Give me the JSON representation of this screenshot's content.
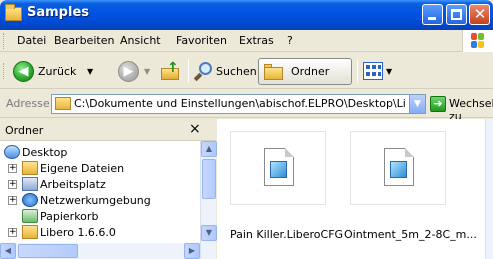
{
  "window": {
    "title": "Samples"
  },
  "menu": [
    "Datei",
    "Bearbeiten",
    "Ansicht",
    "Favoriten",
    "Extras",
    "?"
  ],
  "toolbar": {
    "back_label": "Zurück",
    "search_label": "Suchen",
    "folders_label": "Ordner"
  },
  "address": {
    "label": "Adresse",
    "path": "C:\\Dokumente und Einstellungen\\abischof.ELPRO\\Desktop\\Li",
    "go_label": "Wechseln zu"
  },
  "folder_pane": {
    "title": "Ordner",
    "close_glyph": "×",
    "tree": [
      {
        "label": "Desktop",
        "icon": "desktop-icon",
        "level": 0
      },
      {
        "label": "Eigene Dateien",
        "icon": "my-documents-icon",
        "level": 1
      },
      {
        "label": "Arbeitsplatz",
        "icon": "my-computer-icon",
        "level": 1
      },
      {
        "label": "Netzwerkumgebung",
        "icon": "network-icon",
        "level": 1
      },
      {
        "label": "Papierkorb",
        "icon": "recycle-bin-icon",
        "level": 1
      },
      {
        "label": "Libero 1.6.6.0",
        "icon": "folder-icon",
        "level": 1
      }
    ]
  },
  "files": [
    {
      "name": "Pain Killer.LiberoCFG",
      "icon": "liberocfg-file-icon"
    },
    {
      "name": "Ointment_5m_2-8C_m...",
      "icon": "liberocfg-file-icon"
    }
  ],
  "colors": {
    "titlebar": "#0052e0",
    "chrome": "#ece9d8",
    "close_button": "#c4401d"
  }
}
